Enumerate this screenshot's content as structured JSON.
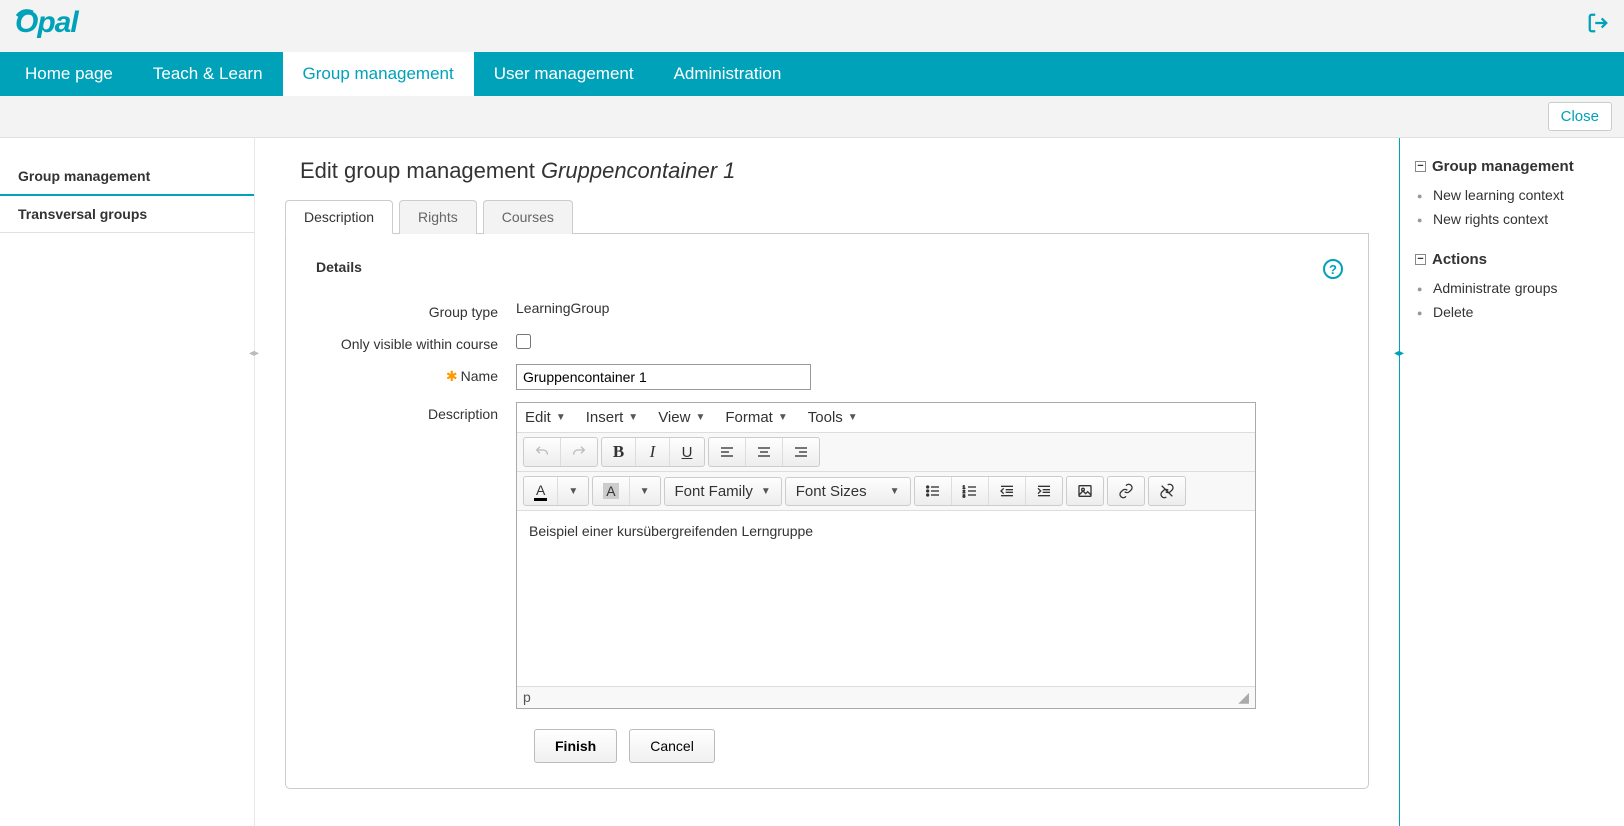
{
  "header": {
    "logo_text": "Opal",
    "logout_icon": "logout-icon"
  },
  "main_nav": [
    {
      "label": "Home page",
      "active": false
    },
    {
      "label": "Teach & Learn",
      "active": false
    },
    {
      "label": "Group management",
      "active": true
    },
    {
      "label": "User management",
      "active": false
    },
    {
      "label": "Administration",
      "active": false
    }
  ],
  "sub_bar": {
    "close_label": "Close"
  },
  "left_sidebar": [
    {
      "label": "Group management",
      "active": true
    },
    {
      "label": "Transversal groups",
      "active": false
    }
  ],
  "page": {
    "title_prefix": "Edit group management ",
    "title_entity": "Gruppencontainer 1",
    "tabs": [
      {
        "label": "Description",
        "active": true
      },
      {
        "label": "Rights",
        "active": false
      },
      {
        "label": "Courses",
        "active": false
      }
    ],
    "section_title": "Details",
    "form": {
      "group_type_label": "Group type",
      "group_type_value": "LearningGroup",
      "visible_label": "Only visible within course",
      "visible_checked": false,
      "name_label": "Name",
      "name_value": "Gruppencontainer 1",
      "description_label": "Description"
    },
    "editor": {
      "menus": [
        "Edit",
        "Insert",
        "View",
        "Format",
        "Tools"
      ],
      "font_family_label": "Font Family",
      "font_sizes_label": "Font Sizes",
      "content": "Beispiel einer kursübergreifenden Lerngruppe",
      "status_path": "p"
    },
    "buttons": {
      "finish": "Finish",
      "cancel": "Cancel"
    }
  },
  "right_sidebar": {
    "section1": {
      "title": "Group management",
      "items": [
        "New learning context",
        "New rights context"
      ]
    },
    "section2": {
      "title": "Actions",
      "items": [
        "Administrate groups",
        "Delete"
      ]
    }
  }
}
